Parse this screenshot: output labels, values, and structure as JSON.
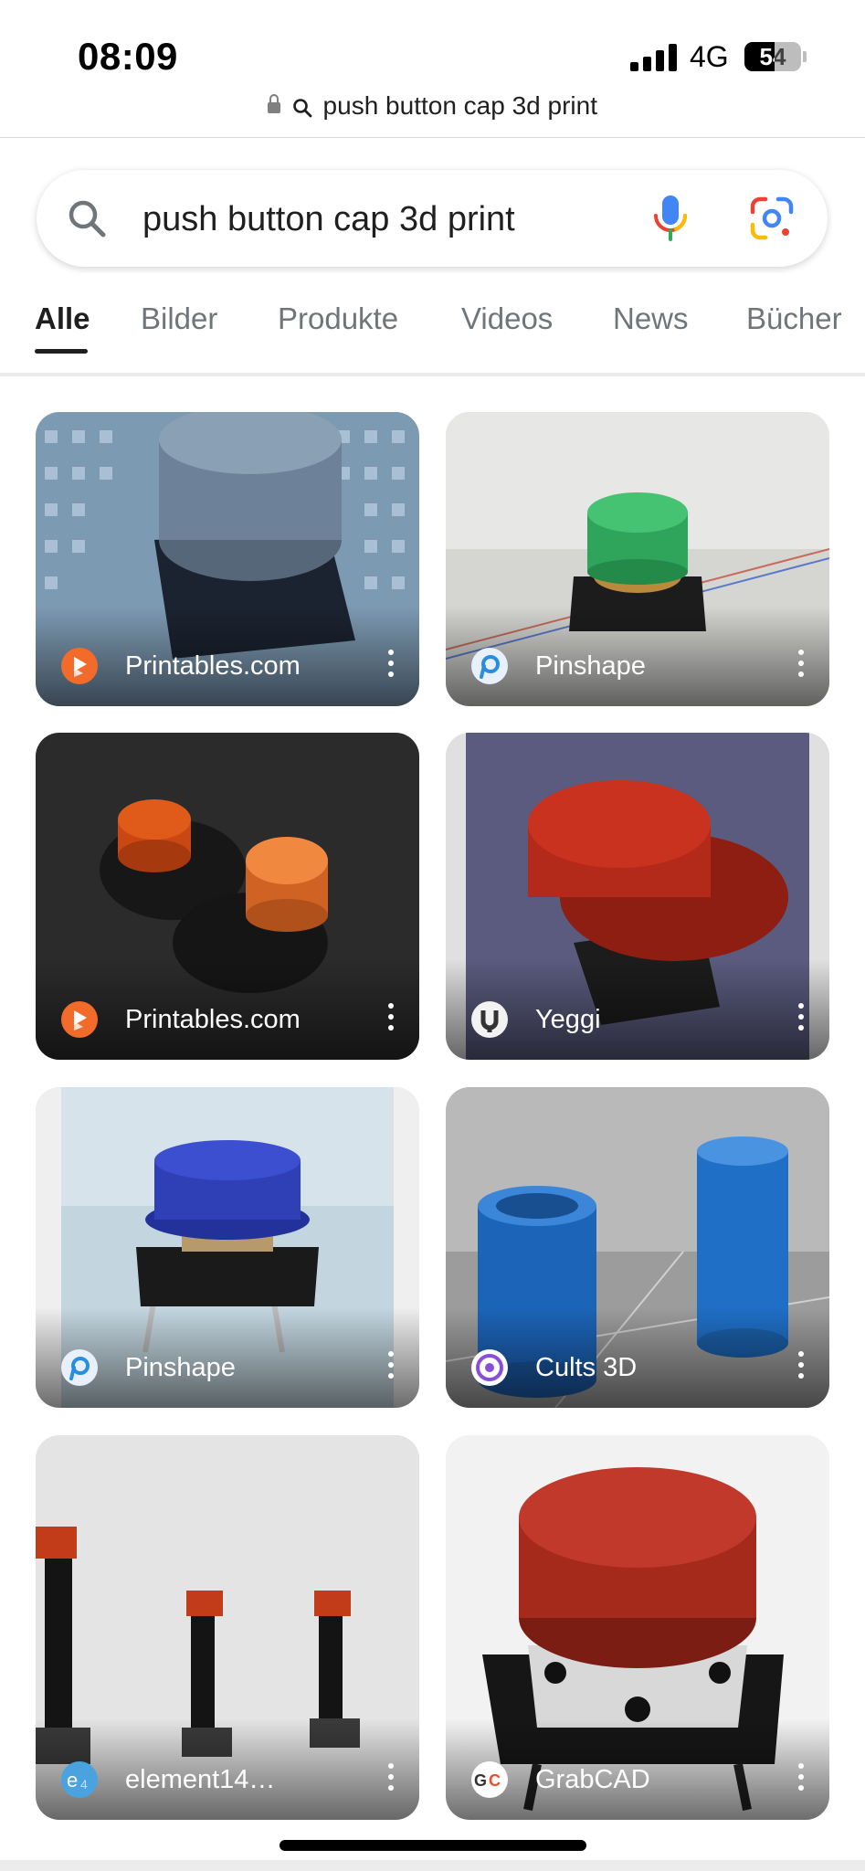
{
  "status": {
    "time": "08:09",
    "network": "4G",
    "battery": "54",
    "battery_level": 0.54
  },
  "browser": {
    "url_text": "push button cap 3d print"
  },
  "search": {
    "query": "push button cap 3d print"
  },
  "tabs": [
    {
      "label": "Alle",
      "active": true
    },
    {
      "label": "Bilder",
      "active": false
    },
    {
      "label": "Produkte",
      "active": false
    },
    {
      "label": "Videos",
      "active": false
    },
    {
      "label": "News",
      "active": false
    },
    {
      "label": "Bücher",
      "active": false
    }
  ],
  "results": [
    {
      "source": "Printables.com",
      "favicon": "printables-icon",
      "image": "grey-cap-on-breadboard"
    },
    {
      "source": "Pinshape",
      "favicon": "pinshape-icon",
      "image": "green-cap-on-breadboard"
    },
    {
      "source": "Printables.com",
      "favicon": "printables-icon",
      "image": "orange-caps-on-table"
    },
    {
      "source": "Yeggi",
      "favicon": "yeggi-icon",
      "image": "red-cap-render"
    },
    {
      "source": "Pinshape",
      "favicon": "pinshape-icon",
      "image": "blue-cap-on-switch-render"
    },
    {
      "source": "Cults 3D",
      "favicon": "cults3d-icon",
      "image": "blue-cylinder-caps-render"
    },
    {
      "source": "element14…",
      "favicon": "element14-icon",
      "image": "red-caps-on-tall-switches"
    },
    {
      "source": "GrabCAD",
      "favicon": "grabcad-icon",
      "image": "red-cap-on-tactile-switch-render"
    }
  ],
  "colors": {
    "accent_text": "#1f1f1f",
    "inactive_tab": "#70757a",
    "printables": "#f26b2a",
    "pinshape": "#2a8ee0",
    "cults": "#8a4fd8"
  }
}
